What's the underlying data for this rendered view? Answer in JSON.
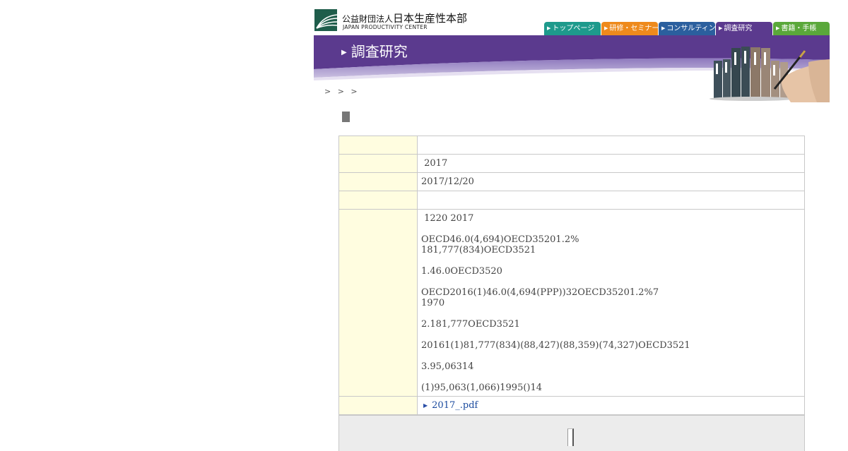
{
  "header": {
    "org_type": "公益財団法人",
    "org_name": "日本生産性本部",
    "org_name_en": "JAPAN PRODUCTIVITY CENTER"
  },
  "nav": {
    "tabs": [
      {
        "label": "トップページ",
        "color": "#1e9a8c"
      },
      {
        "label": "研修・セミナー",
        "color": "#ee8a1c"
      },
      {
        "label": "コンサルティング",
        "color": "#2b5f9e"
      },
      {
        "label": "調査研究",
        "color": "#5b3a8e"
      },
      {
        "label": "書籍・手帳",
        "color": "#5aa83a"
      }
    ]
  },
  "banner": {
    "title": "調査研究",
    "color": "#5b3a8e"
  },
  "breadcrumb": "> > >",
  "table": {
    "rows": [
      {
        "value": ""
      },
      {
        "value": " 2017"
      },
      {
        "value": "2017/12/20"
      },
      {
        "value": ""
      }
    ],
    "body_paragraphs": [
      " 1220 2017",
      "OECD46.0(4,694)OECD35201.2%\n181,777(834)OECD3521",
      "1.46.0OECD3520",
      "OECD2016(1)46.0(4,694(PPP))32OECD35201.2%7\n1970",
      "2.181,777OECD3521",
      "20161(1)81,777(834)(88,427)(88,359)(74,327)OECD3521",
      "3.95,06314",
      "(1)95,063(1,066)1995()14"
    ],
    "pdf_link": "2017_.pdf"
  }
}
